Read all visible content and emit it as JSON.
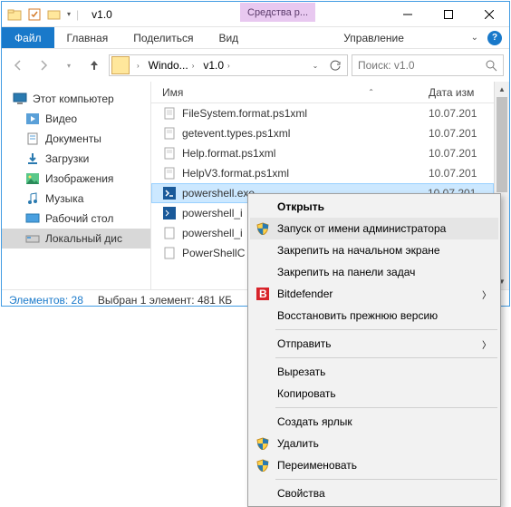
{
  "titlebar": {
    "title": "v1.0",
    "context_tab": "Средства р..."
  },
  "ribbon": {
    "file": "Файл",
    "home": "Главная",
    "share": "Поделиться",
    "view": "Вид",
    "manage": "Управление"
  },
  "breadcrumb": {
    "seg1": "Windo...",
    "seg2": "v1.0"
  },
  "search": {
    "placeholder": "Поиск: v1.0"
  },
  "tree": {
    "this_pc": "Этот компьютер",
    "videos": "Видео",
    "documents": "Документы",
    "downloads": "Загрузки",
    "pictures": "Изображения",
    "music": "Музыка",
    "desktop": "Рабочий стол",
    "local_disk": "Локальный дис"
  },
  "columns": {
    "name": "Имя",
    "date": "Дата изм"
  },
  "files": [
    {
      "name": "FileSystem.format.ps1xml",
      "date": "10.07.201"
    },
    {
      "name": "getevent.types.ps1xml",
      "date": "10.07.201"
    },
    {
      "name": "Help.format.ps1xml",
      "date": "10.07.201"
    },
    {
      "name": "HelpV3.format.ps1xml",
      "date": "10.07.201"
    },
    {
      "name": "powershell.exe",
      "date": "10.07.201"
    },
    {
      "name": "powershell_i",
      "date": ""
    },
    {
      "name": "powershell_i",
      "date": ""
    },
    {
      "name": "PowerShellC",
      "date": ""
    }
  ],
  "status": {
    "count": "Элементов: 28",
    "selection": "Выбран 1 элемент: 481 КБ"
  },
  "menu": {
    "open": "Открыть",
    "runas": "Запуск от имени администратора",
    "pin_start": "Закрепить на начальном экране",
    "pin_taskbar": "Закрепить на панели задач",
    "bitdefender": "Bitdefender",
    "restore": "Восстановить прежнюю версию",
    "sendto": "Отправить",
    "cut": "Вырезать",
    "copy": "Копировать",
    "shortcut": "Создать ярлык",
    "delete": "Удалить",
    "rename": "Переименовать",
    "properties": "Свойства"
  }
}
